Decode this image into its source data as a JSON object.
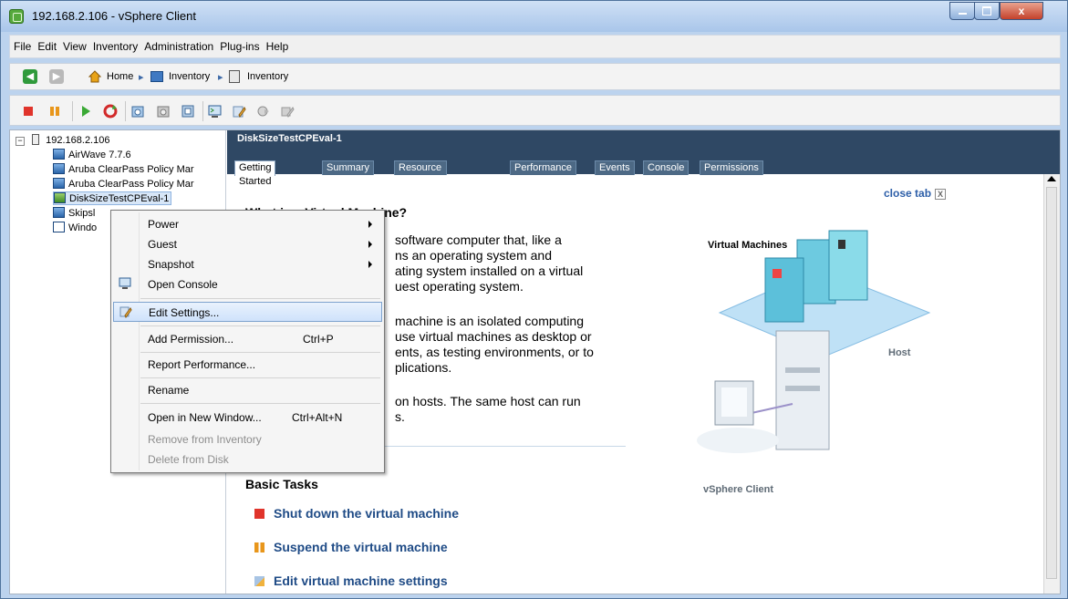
{
  "window": {
    "title": "192.168.2.106 - vSphere Client",
    "close_label": "x",
    "min_label": "",
    "max_label": ""
  },
  "menubar": [
    "File",
    "Edit",
    "View",
    "Inventory",
    "Administration",
    "Plug-ins",
    "Help"
  ],
  "breadcrumb": {
    "home": "Home",
    "inventory1": "Inventory",
    "inventory2": "Inventory"
  },
  "tree": {
    "host": "192.168.2.106",
    "items": [
      "AirWave 7.7.6",
      "Aruba ClearPass Policy Mar",
      "Aruba ClearPass Policy Mar",
      "DiskSizeTestCPEval-1",
      "Skipsl",
      "Windo"
    ]
  },
  "content": {
    "header_title": "DiskSizeTestCPEval-1",
    "tabs": [
      "Getting Started",
      "Summary",
      "Resource Allocation",
      "Performance",
      "Events",
      "Console",
      "Permissions"
    ],
    "close_tab": "close tab",
    "heading": "What is a Virtual Machine?",
    "para1": [
      "software computer that, like a",
      "ns an operating system and",
      "ating system installed on a virtual",
      "uest operating system."
    ],
    "para2": [
      "machine is an isolated computing",
      "use virtual machines as desktop or",
      "ents, as testing environments, or to",
      "plications."
    ],
    "para3": [
      "on hosts. The same host can run",
      "s."
    ],
    "basic_tasks": "Basic Tasks",
    "tasks": [
      "Shut down the virtual machine",
      "Suspend the virtual machine",
      "Edit virtual machine settings"
    ],
    "diagram": {
      "vm_label": "Virtual Machines",
      "host_label": "Host",
      "client_label": "vSphere Client"
    }
  },
  "context_menu": {
    "items": [
      {
        "label": "Power",
        "submenu": true
      },
      {
        "label": "Guest",
        "submenu": true
      },
      {
        "label": "Snapshot",
        "submenu": true
      },
      {
        "label": "Open Console"
      },
      {
        "label": "Edit Settings..."
      },
      {
        "label": "Add Permission...",
        "shortcut": "Ctrl+P"
      },
      {
        "label": "Report Performance..."
      },
      {
        "label": "Rename"
      },
      {
        "label": "Open in New Window...",
        "shortcut": "Ctrl+Alt+N"
      },
      {
        "label": "Remove from Inventory",
        "disabled": true
      },
      {
        "label": "Delete from Disk",
        "disabled": true
      }
    ]
  },
  "colors": {
    "header_bg": "#2f4864",
    "task_link": "#1f4b86",
    "stop_red": "#e0342b",
    "suspend_orange": "#e8961b"
  }
}
